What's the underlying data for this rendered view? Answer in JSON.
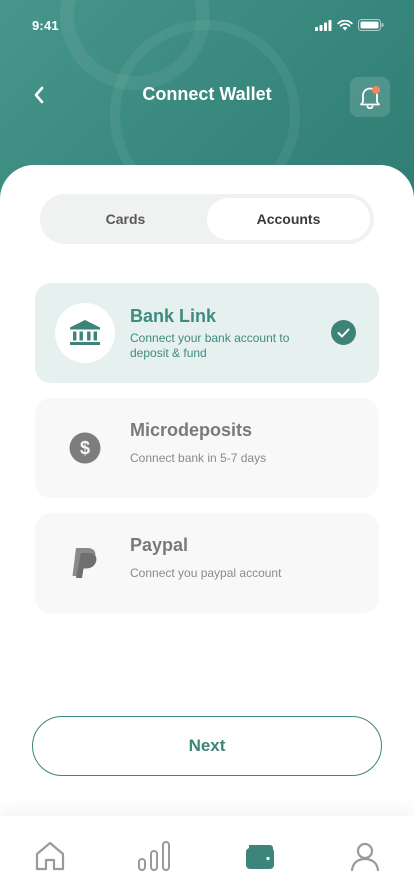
{
  "status_bar": {
    "time": "9:41"
  },
  "header": {
    "title": "Connect Wallet"
  },
  "segments": [
    {
      "label": "Cards",
      "active": false
    },
    {
      "label": "Accounts",
      "active": true
    }
  ],
  "options": [
    {
      "title": "Bank Link",
      "description": "Connect your bank account to deposit & fund",
      "icon": "bank-icon",
      "selected": true
    },
    {
      "title": "Microdeposits",
      "description": "Connect bank in 5-7 days",
      "icon": "dollar-coin-icon",
      "selected": false
    },
    {
      "title": "Paypal",
      "description": "Connect you paypal account",
      "icon": "paypal-icon",
      "selected": false
    }
  ],
  "next_button": {
    "label": "Next"
  },
  "tab_bar": {
    "items": [
      {
        "icon": "home-icon",
        "active": false
      },
      {
        "icon": "bar-chart-icon",
        "active": false
      },
      {
        "icon": "wallet-icon",
        "active": true
      },
      {
        "icon": "profile-icon",
        "active": false
      }
    ]
  },
  "colors": {
    "primary": "#3d857b",
    "header_gradient_start": "#47968c",
    "header_gradient_end": "#2f7c73",
    "notification_dot": "#f08a5d",
    "selected_card_bg": "#e6f0ee",
    "icon_inactive": "#9a9a9a"
  }
}
